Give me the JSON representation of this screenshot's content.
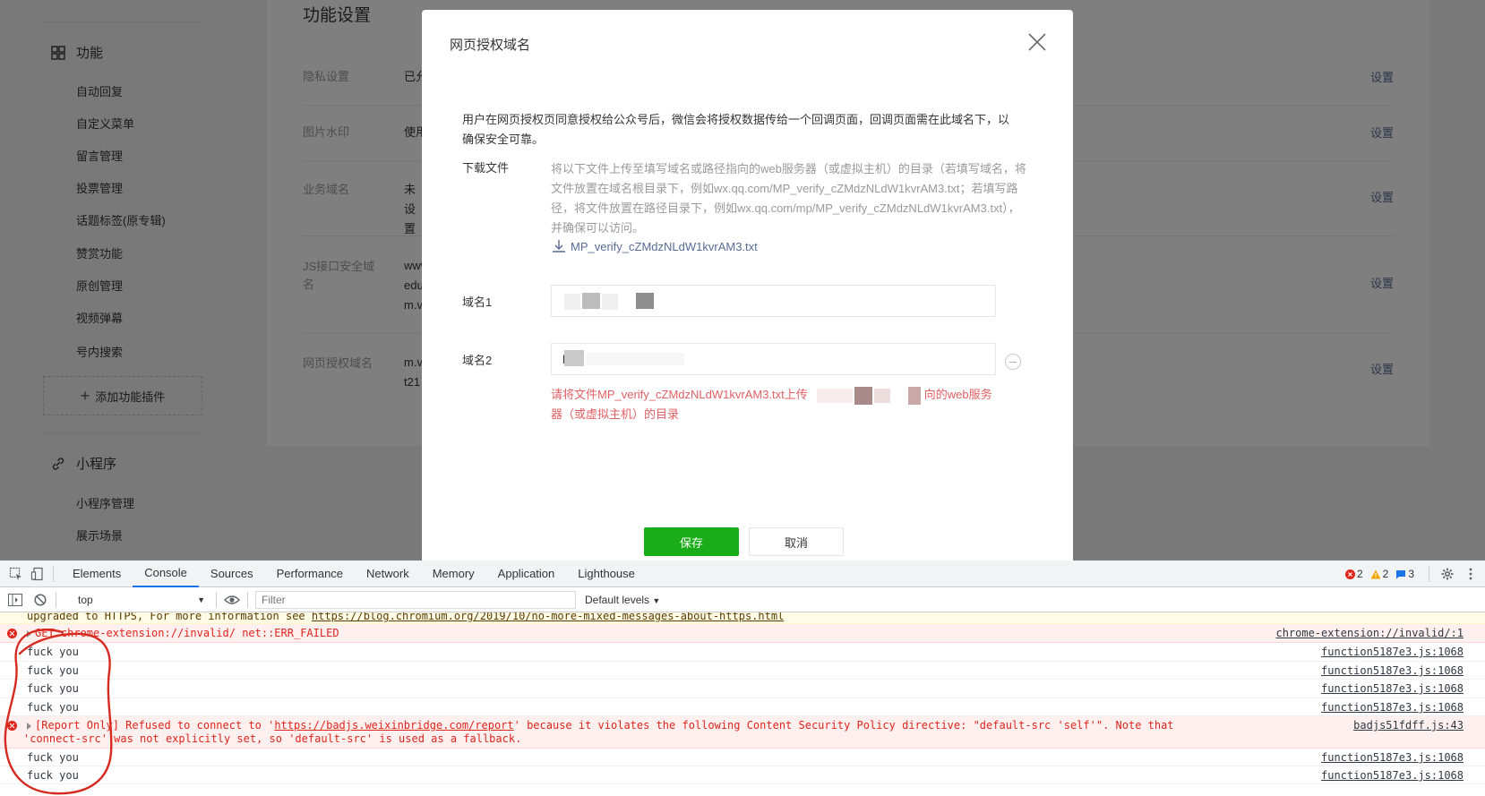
{
  "sidebar": {
    "section1": {
      "label": "功能"
    },
    "items1": [
      "自动回复",
      "自定义菜单",
      "留言管理",
      "投票管理",
      "话题标签(原专辑)",
      "赞赏功能",
      "原创管理",
      "视频弹幕",
      "号内搜索"
    ],
    "add_plugin": "添加功能插件",
    "section2": {
      "label": "小程序"
    },
    "items2": [
      "小程序管理",
      "展示场景"
    ]
  },
  "panel": {
    "title": "功能设置",
    "rows": [
      {
        "label": "隐私设置",
        "value": "已允",
        "action": "设置"
      },
      {
        "label": "图片水印",
        "value": "使用",
        "action": "设置"
      },
      {
        "label": "业务域名",
        "value": "未设置",
        "action": "设置"
      },
      {
        "label": "JS接口安全域名",
        "value": "www edu m.v",
        "action": "设置"
      },
      {
        "label": "网页授权域名",
        "value": "m.v t21",
        "action": "设置"
      }
    ]
  },
  "dialog": {
    "title": "网页授权域名",
    "intro": "用户在网页授权页同意授权给公众号后，微信会将授权数据传给一个回调页面，回调页面需在此域名下，以确保安全可靠。",
    "download_label": "下载文件",
    "download_desc": "将以下文件上传至填写域名或路径指向的web服务器（或虚拟主机）的目录（若填写域名，将文件放置在域名根目录下，例如wx.qq.com/MP_verify_cZMdzNLdW1kvrAM3.txt；若填写路径，将文件放置在路径目录下，例如wx.qq.com/mp/MP_verify_cZMdzNLdW1kvrAM3.txt），并确保可以访问。",
    "download_file": "MP_verify_cZMdzNLdW1kvrAM3.txt",
    "domain1_label": "域名1",
    "domain2_label": "域名2",
    "domain2_value": "l",
    "error_prefix": "请将文件MP_verify_cZMdzNLdW1kvrAM3.txt上传",
    "error_suffix": "向的web服务器（或虚拟主机）的目录",
    "save_label": "保存",
    "cancel_label": "取消"
  },
  "devtools": {
    "tabs": [
      "Elements",
      "Console",
      "Sources",
      "Performance",
      "Network",
      "Memory",
      "Application",
      "Lighthouse"
    ],
    "active_tab": "Console",
    "errors_count": "2",
    "warnings_count": "2",
    "info_count": "3",
    "context": "top",
    "filter_placeholder": "Filter",
    "levels": "Default levels",
    "logs": [
      {
        "type": "warn-clip",
        "msg": "upgraded to HTTPS, For more information see ",
        "link": "https://blog.chromium.org/2019/10/no-more-mixed-messages-about-https.html",
        "src": ""
      },
      {
        "type": "error",
        "msg": "GET chrome-extension://invalid/ net::ERR_FAILED",
        "src": "chrome-extension://invalid/:1"
      },
      {
        "type": "log",
        "msg": "fuck you",
        "src": "function5187e3.js:1068"
      },
      {
        "type": "log",
        "msg": "fuck you",
        "src": "function5187e3.js:1068"
      },
      {
        "type": "log",
        "msg": "fuck you",
        "src": "function5187e3.js:1068"
      },
      {
        "type": "log",
        "msg": "fuck you",
        "src": "function5187e3.js:1068"
      },
      {
        "type": "error",
        "msg_pre": "[Report Only] Refused to connect to '",
        "link": "https://badjs.weixinbridge.com/report",
        "msg_post": "' because it violates the following Content Security Policy directive: \"default-src 'self'\". Note that",
        "msg_line2": "'connect-src' was not explicitly set, so 'default-src' is used as a fallback.",
        "src": "badjs51fdff.js:43"
      },
      {
        "type": "log",
        "msg": "fuck you",
        "src": "function5187e3.js:1068"
      },
      {
        "type": "log",
        "msg": "fuck you",
        "src": "function5187e3.js:1068"
      }
    ]
  },
  "colors": {
    "primary_green": "#1aad19",
    "link_blue": "#576b95",
    "error_red": "#e15f63",
    "annotation_red": "#d62a20"
  }
}
